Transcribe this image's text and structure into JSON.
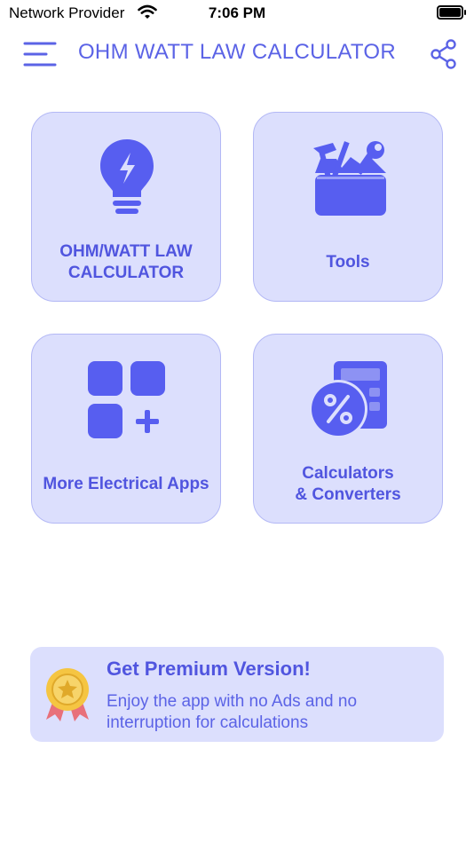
{
  "status": {
    "carrier": "Network Provider",
    "time": "7:06 PM"
  },
  "header": {
    "title": "OHM WATT LAW CALCULATOR"
  },
  "tiles": [
    {
      "label": "OHM/WATT LAW\nCALCULATOR",
      "icon": "bulb-icon"
    },
    {
      "label": "Tools",
      "icon": "toolbox-icon"
    },
    {
      "label": "More Electrical Apps",
      "icon": "apps-grid-icon"
    },
    {
      "label": "Calculators\n& Converters",
      "icon": "calculator-percent-icon"
    }
  ],
  "premium": {
    "title": "Get Premium Version!",
    "description": "Enjoy the app with no Ads and no interruption for calculations"
  },
  "colors": {
    "accent": "#5b63e6",
    "tile_bg": "#dcdffd",
    "tile_border": "#b3b8f5",
    "icon": "#575ef0"
  }
}
